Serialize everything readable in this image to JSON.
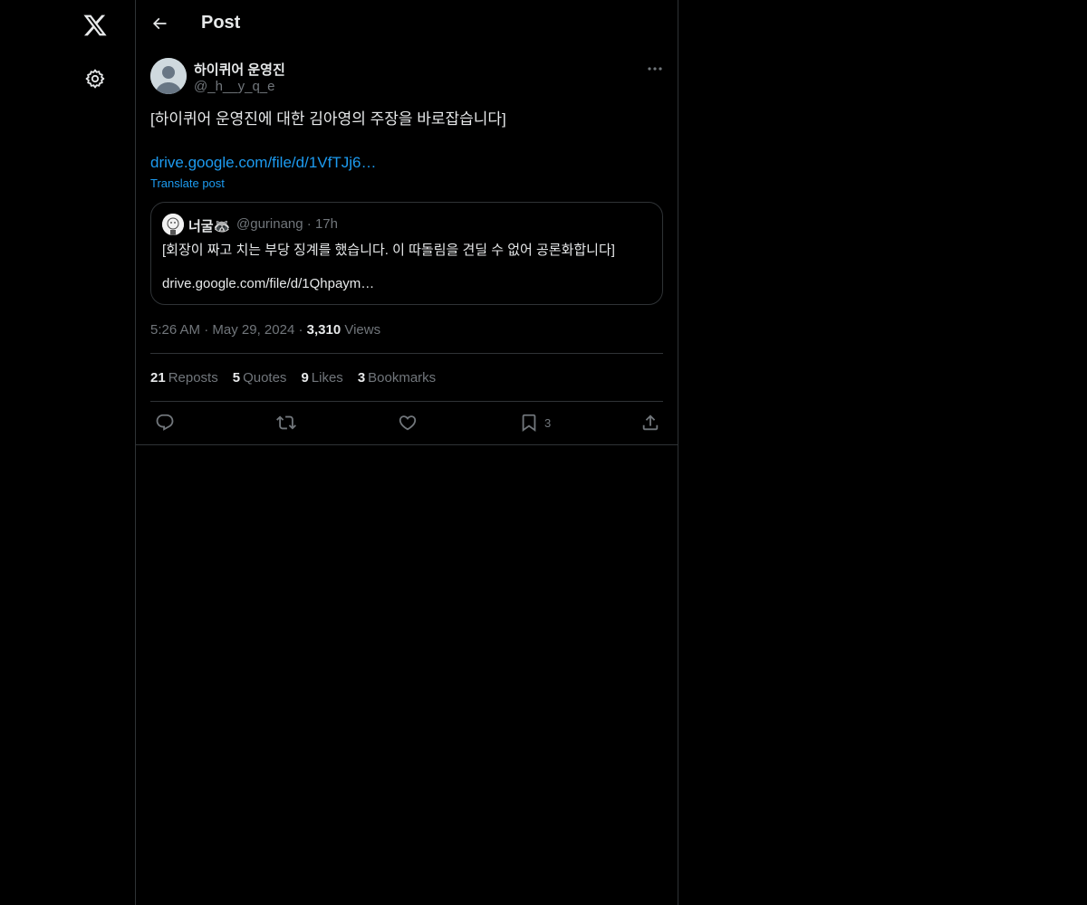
{
  "header": {
    "title": "Post"
  },
  "post": {
    "author_name": "하이퀴어 운영진",
    "author_handle": "@_h__y_q_e",
    "text": "[하이퀴어 운영진에 대한 김아영의 주장을 바로잡습니다]",
    "link": "drive.google.com/file/d/1VfTJj6…",
    "translate_label": "Translate post",
    "time": "5:26 AM",
    "date": "May 29, 2024",
    "views_count": "3,310",
    "views_label": "Views"
  },
  "quoted": {
    "name": "너굴🦝",
    "handle": "@gurinang",
    "age": "17h",
    "text": "[회장이 짜고 치는 부당 징계를 했습니다. 이 따돌림을 견딜 수 없어 공론화합니다]",
    "link": "drive.google.com/file/d/1Qhpaym…"
  },
  "stats": {
    "reposts_count": "21",
    "reposts_label": "Reposts",
    "quotes_count": "5",
    "quotes_label": "Quotes",
    "likes_count": "9",
    "likes_label": "Likes",
    "bookmarks_count": "3",
    "bookmarks_label": "Bookmarks"
  },
  "actions": {
    "bookmark_count": "3"
  },
  "icons": {
    "logo": "x-logo-icon",
    "settings": "gear-icon",
    "back": "arrow-left-icon",
    "more": "more-horizontal-icon",
    "reply": "reply-icon",
    "repost": "repost-icon",
    "like": "heart-icon",
    "bookmark": "bookmark-icon",
    "share": "share-icon"
  },
  "colors": {
    "background": "#000000",
    "text": "#e7e9ea",
    "secondary": "#71767b",
    "link": "#1d9bf0",
    "border": "#2f3336"
  }
}
